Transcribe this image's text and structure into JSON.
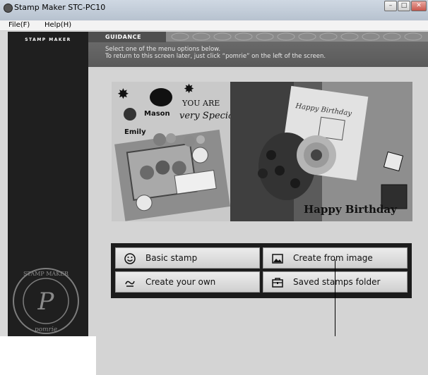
{
  "window": {
    "title": "Stamp Maker STC-PC10"
  },
  "menubar": {
    "file": "File(F)",
    "help": "Help(H)"
  },
  "sidebar": {
    "logo": "pomrie",
    "logo_sub": "STAMP MAKER",
    "seal_text_top": "STAMP MAKER",
    "seal_text_bottom": "pomrie",
    "seal_initial": "P"
  },
  "guidance": {
    "heading": "GUIDANCE",
    "line1": "Select one of the menu options below.",
    "line2": "To return to this screen later, just click “pomrie” on the left of the screen."
  },
  "hero": {
    "left_card": {
      "you_are": "YOU ARE",
      "very_special": "very Special",
      "names": [
        "Mason",
        "Emily"
      ]
    },
    "right_card": {
      "happy_birthday_top": "Happy Birthday",
      "happy_birthday_bottom": "Happy Birthday"
    }
  },
  "menu": {
    "basic_stamp": "Basic stamp",
    "create_from_image": "Create from image",
    "create_your_own": "Create your own",
    "saved_stamps_folder": "Saved stamps folder"
  },
  "colors": {
    "sidebar": "#1f1f1f",
    "guidance_bar": "#5f5f5f",
    "menu_frame": "#1c1c1c"
  }
}
